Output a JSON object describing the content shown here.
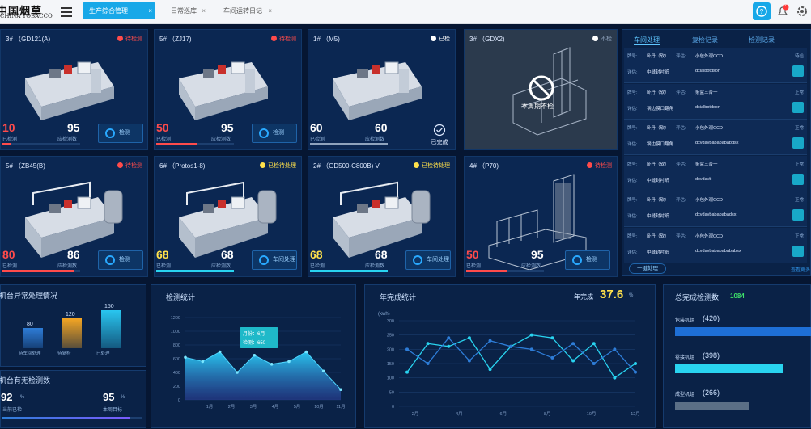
{
  "header": {
    "logo_cn": "中国烟草",
    "logo_en": "CHINA TOBACCO",
    "tabs": [
      {
        "label": "生产综合管理",
        "active": true
      },
      {
        "label": "日常巡库",
        "active": false
      },
      {
        "label": "车间运转日记",
        "active": false
      }
    ],
    "notification_count": "2",
    "accent": "#18a8e8"
  },
  "machines": [
    {
      "title": "3# （GD121(A)",
      "status": "待检测",
      "status_color": "#ff4b4b",
      "a": "10",
      "a_label": "已检测",
      "a_color": "#ff4b4b",
      "b": "95",
      "b_label": "应检测数",
      "progress": 0.11,
      "bar_color": "#ff4b4b",
      "action": "检测",
      "icon": "packer-machine-icon"
    },
    {
      "title": "5# （ZJ17)",
      "status": "待检测",
      "status_color": "#ff4b4b",
      "a": "50",
      "a_label": "已检测",
      "a_color": "#ff4b4b",
      "b": "95",
      "b_label": "应检测数",
      "progress": 0.53,
      "bar_color": "#ff4b4b",
      "action": "检测",
      "icon": "packer-machine-icon"
    },
    {
      "title": "1# （M5)",
      "status": "已检",
      "status_color": "#ffffff",
      "a": "60",
      "a_label": "已检测",
      "a_color": "#ffffff",
      "b": "60",
      "b_label": "应检测数",
      "progress": 1.0,
      "bar_color": "#8fa3bd",
      "action": "已完成",
      "icon": "packer-machine-icon"
    },
    {
      "title": "3# （GDX2)",
      "status": "不检",
      "status_color": "#8fa3bd",
      "a": "",
      "a_label": "",
      "a_color": "#ffffff",
      "b": "",
      "b_label": "",
      "progress": 0,
      "bar_color": "#8fa3bd",
      "action": "本周期不检",
      "icon": "banned-icon",
      "grey": true
    },
    {
      "title": "5# （ZB45(B)",
      "status": "待检测",
      "status_color": "#ff4b4b",
      "a": "80",
      "a_label": "已检测",
      "a_color": "#ff4b4b",
      "b": "86",
      "b_label": "应检测数",
      "progress": 0.93,
      "bar_color": "#ff4b4b",
      "action": "检测",
      "icon": "maker-machine-icon"
    },
    {
      "title": "6# （Protos1-8)",
      "status": "已检待处理",
      "status_color": "#ffe14b",
      "a": "68",
      "a_label": "已检测",
      "a_color": "#ffe14b",
      "b": "68",
      "b_label": "应检测数",
      "progress": 1.0,
      "bar_color": "#29d4f0",
      "action": "车间处理",
      "icon": "maker-machine-icon"
    },
    {
      "title": "2# （GD500-C800B) V",
      "status": "已检待处理",
      "status_color": "#ffe14b",
      "a": "68",
      "a_label": "已检测",
      "a_color": "#ffe14b",
      "b": "68",
      "b_label": "应检测数",
      "progress": 1.0,
      "bar_color": "#29d4f0",
      "action": "车间处理",
      "icon": "maker-machine-icon"
    },
    {
      "title": "4# （P70)",
      "status": "待检测",
      "status_color": "#ff4b4b",
      "a": "50",
      "a_label": "已检测",
      "a_color": "#ff4b4b",
      "b": "95",
      "b_label": "应检测数",
      "progress": 0.53,
      "bar_color": "#ff4b4b",
      "action": "检测",
      "icon": "frame-machine-icon"
    }
  ],
  "right_panel": {
    "tabs": [
      "车间处理",
      "复检记录",
      "检测记录"
    ],
    "rows": [
      {
        "col1": "卧丹（软）",
        "col2": "小包外观CCD",
        "l1": "牌号:",
        "l2": "评估:",
        "l3": "详估:",
        "d": "中缝封衬纸",
        "code": "dcialbotdson",
        "status": "待检"
      },
      {
        "col1": "卧丹（软）",
        "col2": "条盒三合一",
        "l1": "牌号:",
        "l2": "评估:",
        "l3": "详估:",
        "d": "钢边膜口翻角",
        "code": "dcialbotdson",
        "status": "正常"
      },
      {
        "col1": "卧丹（软）",
        "col2": "小包外观CCD",
        "l1": "牌号:",
        "l2": "评估:",
        "l3": "详估:",
        "d": "钢边膜口翻角",
        "code": "dcvdavbababababdsx",
        "status": "正常"
      },
      {
        "col1": "卧丹（软）",
        "col2": "条盒三合一",
        "l1": "牌号:",
        "l2": "评估:",
        "l3": "详估:",
        "d": "中缝封衬纸",
        "code": "dcvdavb",
        "status": "正常"
      },
      {
        "col1": "卧丹（软）",
        "col2": "小包外观CCD",
        "l1": "牌号:",
        "l2": "评估:",
        "l3": "详估:",
        "d": "中缝封衬纸",
        "code": "dcvdavbabababadsx",
        "status": "正常"
      },
      {
        "col1": "卧丹（软）",
        "col2": "小包外观CCD",
        "l1": "牌号:",
        "l2": "评估:",
        "l3": "详估:",
        "d": "中缝封衬纸",
        "code": "dcvdavbabababababsx",
        "status": "正常"
      }
    ],
    "one_click": "一键处理",
    "more": "查看更多"
  },
  "exception_panel": {
    "title": "机台异常处理情况",
    "bars": [
      {
        "label": "待车间处理",
        "value": 80,
        "color": "#2e7dd8"
      },
      {
        "label": "待复检",
        "value": 120,
        "color": "#f5a623"
      },
      {
        "label": "已处理",
        "value": 150,
        "color": "#29c6f0"
      }
    ],
    "max": 160
  },
  "nocheck_panel": {
    "title": "机台有无检测数",
    "a": "92",
    "a_unit": "%",
    "a_label": "当前已检",
    "b": "95",
    "b_unit": "%",
    "b_label": "本周目标",
    "progress": 0.92
  },
  "detect_stats": {
    "title": "检测统计",
    "tooltip_month": "月份：6月",
    "tooltip_value": "检测：650",
    "chart_data": {
      "type": "area",
      "x": [
        "1月",
        "3月",
        "4月",
        "5月",
        "6月",
        "7月",
        "8月",
        "9月",
        "10月",
        "11月"
      ],
      "values": [
        620,
        560,
        700,
        400,
        650,
        520,
        560,
        700,
        420,
        150
      ],
      "ylim": [
        0,
        1200
      ],
      "yticks": [
        0,
        200,
        400,
        600,
        800,
        1000,
        1200
      ],
      "xticks": [
        "1月",
        "2月",
        "3月",
        "4月",
        "5月",
        "10月",
        "11月"
      ]
    }
  },
  "year_stats": {
    "title": "年完成统计",
    "done_label": "年完成",
    "done_value": "37.6",
    "done_unit": "%",
    "yunit": "(kwh)",
    "chart_data": {
      "type": "line",
      "x": [
        "1月",
        "2月",
        "3月",
        "4月",
        "5月",
        "6月",
        "7月",
        "8月",
        "9月",
        "10月",
        "11月",
        "12月"
      ],
      "xticks": [
        "2月",
        "4月",
        "6月",
        "8月",
        "10月",
        "12月"
      ],
      "series": [
        {
          "values": [
            120,
            220,
            210,
            240,
            130,
            210,
            250,
            240,
            160,
            220,
            100,
            150
          ],
          "color": "#29d4f0"
        },
        {
          "values": [
            200,
            150,
            240,
            160,
            230,
            210,
            200,
            170,
            220,
            150,
            200,
            120
          ],
          "color": "#2e7dd8"
        }
      ],
      "ylim": [
        0,
        300
      ],
      "yticks": [
        0,
        50,
        100,
        150,
        200,
        250,
        300
      ]
    }
  },
  "total_checks": {
    "title": "总完成检测数",
    "value": "1084",
    "items": [
      {
        "name": "包装机组",
        "value": "420",
        "fraction": 1.0,
        "color": "#1e6fd6"
      },
      {
        "name": "卷接机组",
        "value": "398",
        "fraction": 0.8,
        "color": "#29d4f0"
      },
      {
        "name": "成型机组",
        "value": "266",
        "fraction": 0.54,
        "color": "#5b6f86"
      }
    ]
  }
}
